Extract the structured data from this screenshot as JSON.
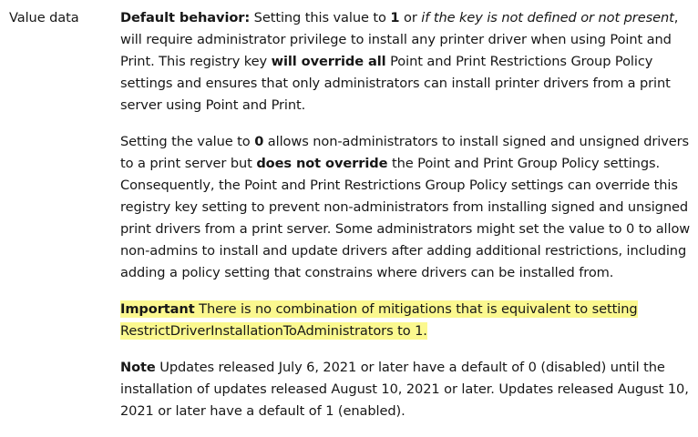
{
  "field_label": "Value data",
  "p1": {
    "lead": "Default behavior:",
    "t1": " Setting this value to ",
    "one": "1",
    "t2": " or ",
    "cond": "if the key is not defined or not present",
    "t3": ", will require administrator privilege to install any printer driver when using Point and Print. This registry key ",
    "override": "will override all",
    "t4": " Point and Print Restrictions Group Policy settings and ensures that only administrators can install printer drivers from a print server using Point and Print."
  },
  "p2": {
    "t1": "Setting the value to ",
    "zero": "0",
    "t2": " allows non-administrators to install signed and unsigned drivers to a print server but ",
    "no_override": "does not override",
    "t3": " the Point and Print Group Policy settings. Consequently, the Point and Print Restrictions Group Policy settings can override this registry key setting to prevent non-administrators from installing signed and unsigned print drivers from a print server. Some administrators might set the value to 0 to allow non-admins to install and update drivers after adding additional restrictions, including adding a policy setting that constrains where drivers can be installed from."
  },
  "important": {
    "label": "Important",
    "text": " There is no combination of mitigations that is equivalent to setting RestrictDriverInstallationToAdministrators to 1."
  },
  "note": {
    "label": "Note",
    "text": " Updates released July 6, 2021 or later have a default of 0 (disabled) until the installation of updates released August 10, 2021 or later.  Updates released August 10, 2021 or later have a default of 1 (enabled)."
  },
  "colors": {
    "highlight": "#fbf88f",
    "text": "#171717"
  }
}
